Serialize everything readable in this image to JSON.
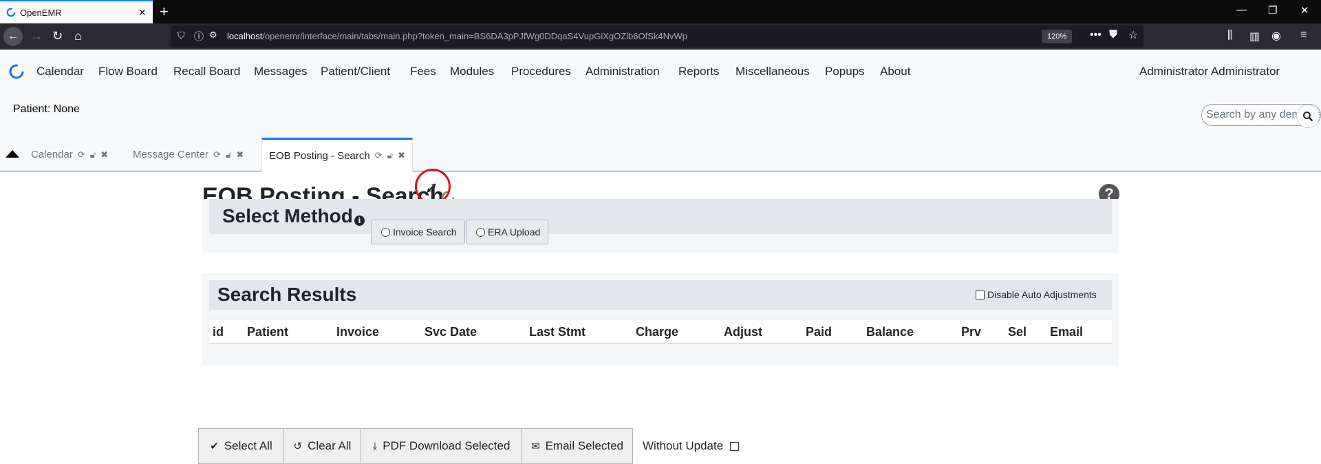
{
  "browser": {
    "tab_title": "OpenEMR",
    "url_host": "localhost",
    "url_path": "/openemr/interface/main/tabs/main.php?token_main=BS6DA3pPJfWg0DDqaS4VupGiXgOZlb6OfSk4NvWp",
    "zoom": "120%"
  },
  "menu": {
    "items": [
      "Calendar",
      "Flow Board",
      "Recall Board",
      "Messages",
      "Patient/Client",
      "Fees",
      "Modules",
      "Procedures",
      "Administration",
      "Reports",
      "Miscellaneous",
      "Popups",
      "About"
    ],
    "user": "Administrator Administrator"
  },
  "patient": {
    "label": "Patient: None"
  },
  "search": {
    "placeholder": "Search by any demographics"
  },
  "app_tabs": [
    {
      "label": "Calendar"
    },
    {
      "label": "Message Center"
    },
    {
      "label": "EOB Posting - Search"
    }
  ],
  "page": {
    "title": "EOB Posting - Search",
    "select_method": {
      "title": "Select Method",
      "options": [
        "Invoice Search",
        "ERA Upload"
      ]
    },
    "search_results": {
      "title": "Search Results",
      "disable_auto_adjust": "Disable Auto Adjustments",
      "columns": [
        "id",
        "Patient",
        "Invoice",
        "Svc Date",
        "Last Stmt",
        "Charge",
        "Adjust",
        "Paid",
        "Balance",
        "Prv",
        "Sel",
        "Email"
      ]
    },
    "actions": {
      "select_all": "Select All",
      "clear_all": "Clear All",
      "pdf_download": "PDF Download Selected",
      "email_selected": "Email Selected",
      "without_update": "Without Update"
    }
  },
  "colors": {
    "accent": "#1a73e8",
    "cursor_ring": "#e0101b"
  },
  "icons": [
    "openemr-logo-icon",
    "refresh-icon",
    "unlock-icon",
    "close-icon",
    "search-icon",
    "help-icon",
    "info-icon",
    "check-icon",
    "undo-icon",
    "download-icon",
    "envelope-icon",
    "expand-icon",
    "spinner-icon"
  ]
}
